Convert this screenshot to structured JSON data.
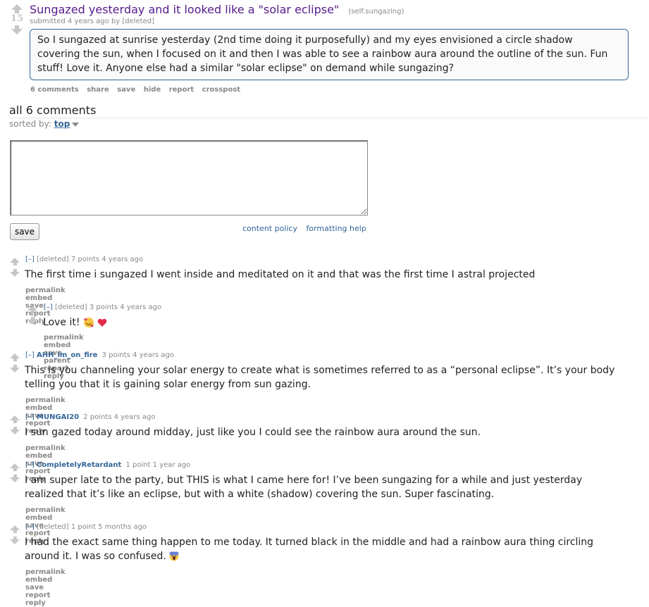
{
  "post": {
    "score": "15",
    "title": "Sungazed yesterday and it looked like a \"solar eclipse\"",
    "domain": "(self.sungazing)",
    "tagline": "submitted 4 years ago by [deleted]",
    "selftext": "So I sungazed at sunrise yesterday (2nd time doing it purposefully) and my eyes envisioned a circle shadow covering the sun, when I focused on it and then I was able to see a rainbow aura around the outline of the sun. Fun stuff! Love it. Anyone else had a similar \"solar eclipse\" on demand while sungazing?",
    "buttons": [
      "6 comments",
      "share",
      "save",
      "hide",
      "report",
      "crosspost"
    ]
  },
  "comments_header": {
    "title": "all 6 comments",
    "sorted_label": "sorted by:",
    "sorted_value": "top"
  },
  "comment_form": {
    "save_label": "save",
    "links": [
      "content policy",
      "formatting help"
    ]
  },
  "comments": [
    {
      "toggle": "[–]",
      "author": "[deleted]",
      "points": "7 points",
      "age": "4 years ago",
      "body": "The first time i sungazed I went inside and meditated on it and that was the first time I astral projected",
      "buttons": [
        "permalink",
        "embed",
        "save",
        "report",
        "reply"
      ]
    },
    {
      "toggle": "[–]",
      "author": "[deleted]",
      "points": "3 points",
      "age": "4 years ago",
      "body": "Love it!",
      "buttons": [
        "permalink",
        "embed",
        "save",
        "parent",
        "report",
        "reply"
      ]
    },
    {
      "toggle": "[–]",
      "author": "AHH_im_on_fire",
      "points": "3 points",
      "age": "4 years ago",
      "body": "This is you channeling your solar energy to create what is sometimes referred to as a “personal eclipse”. It’s your body telling you that it is gaining solar energy from sun gazing.",
      "buttons": [
        "permalink",
        "embed",
        "save",
        "report",
        "reply"
      ]
    },
    {
      "toggle": "[–]",
      "author": "MUNGAI20",
      "points": "2 points",
      "age": "4 years ago",
      "body": "I sun gazed today around midday, just like you I could see the rainbow aura around the sun.",
      "buttons": [
        "permalink",
        "embed",
        "save",
        "report",
        "reply"
      ]
    },
    {
      "toggle": "[–]",
      "author": "CompletelyRetardant",
      "points": "1 point",
      "age": "1 year ago",
      "body": "I am super late to the party, but THIS is what I came here for! I’ve been sungazing for a while and just yesterday realized that it’s like an eclipse, but with a white (shadow) covering the sun. Super fascinating.",
      "buttons": [
        "permalink",
        "embed",
        "save",
        "report",
        "reply"
      ]
    },
    {
      "toggle": "[–]",
      "author": "[deleted]",
      "points": "1 point",
      "age": "5 months ago",
      "body": "I had the exact same thing happen to me today. It turned black in the middle and had a rainbow aura thing circling around it. I was so confused.",
      "buttons": [
        "permalink",
        "embed",
        "save",
        "report",
        "reply"
      ]
    }
  ],
  "colors": {
    "link": "#336699",
    "title_visited": "#551a8b",
    "meta": "#888888",
    "arrow": "#c6c6c6",
    "selftext_border": "#336699"
  },
  "icons": [
    "upvote-arrow-icon",
    "downvote-arrow-icon",
    "caret-down-icon",
    "smiling-face-with-hearts-emoji",
    "red-heart-emoji",
    "face-screaming-emoji"
  ]
}
